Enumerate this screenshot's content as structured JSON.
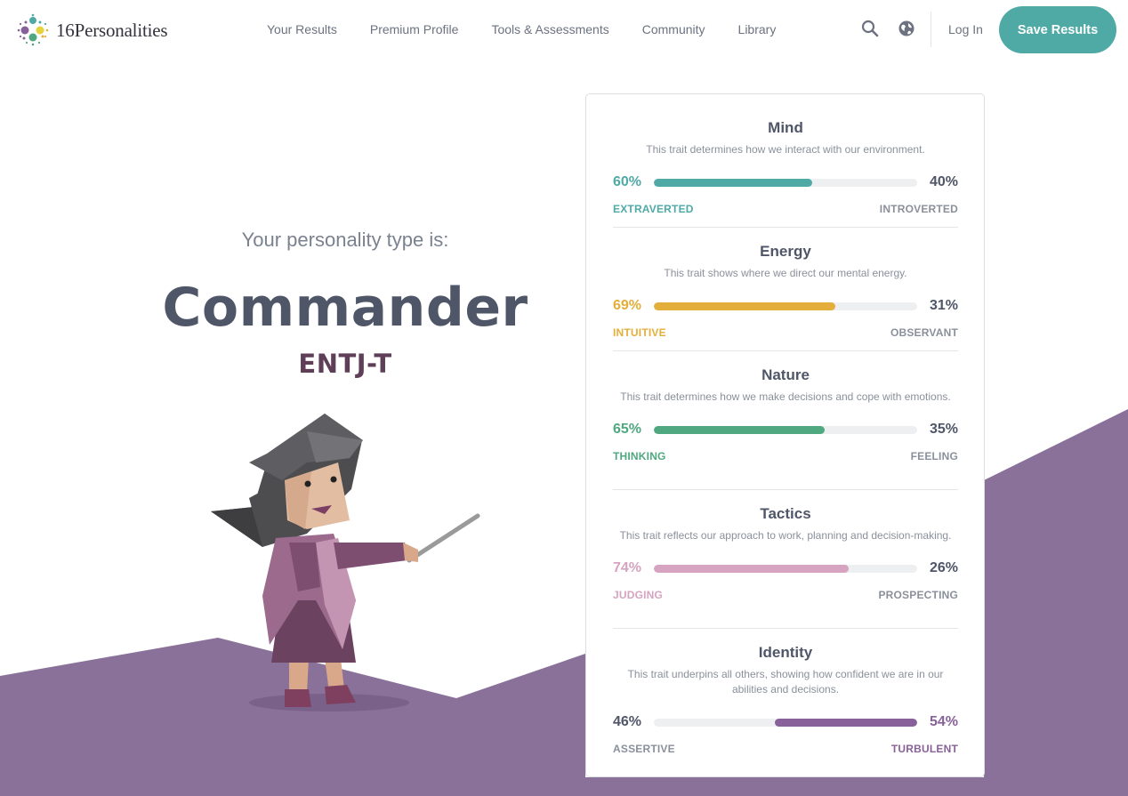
{
  "brand": {
    "name": "16Personalities",
    "colors": {
      "teal": "#4faaa6",
      "purple": "#88619a",
      "bg_purple": "#8a7199"
    }
  },
  "nav": {
    "items": [
      {
        "label": "Your Results"
      },
      {
        "label": "Premium Profile"
      },
      {
        "label": "Tools & Assessments"
      },
      {
        "label": "Community"
      },
      {
        "label": "Library"
      }
    ],
    "search_icon": "search-icon",
    "language_icon": "globe-icon",
    "login_label": "Log In",
    "save_label": "Save Results"
  },
  "intro": {
    "label": "Your personality type is:",
    "type_name": "Commander",
    "type_code": "ENTJ-T"
  },
  "traits": [
    {
      "title": "Mind",
      "description": "This trait determines how we interact with our environment.",
      "left_pct": "60%",
      "right_pct": "40%",
      "left_label": "EXTRAVERTED",
      "right_label": "INTROVERTED",
      "fill_value": 0.6,
      "fill_side": "left",
      "color": "#4faaa6"
    },
    {
      "title": "Energy",
      "description": "This trait shows where we direct our mental energy.",
      "left_pct": "69%",
      "right_pct": "31%",
      "left_label": "INTUITIVE",
      "right_label": "OBSERVANT",
      "fill_value": 0.69,
      "fill_side": "left",
      "color": "#e4ae3a"
    },
    {
      "title": "Nature",
      "description": "This trait determines how we make decisions and cope with emotions.",
      "left_pct": "65%",
      "right_pct": "35%",
      "left_label": "THINKING",
      "right_label": "FEELING",
      "fill_value": 0.65,
      "fill_side": "left",
      "color": "#4fa87f"
    },
    {
      "title": "Tactics",
      "description": "This trait reflects our approach to work, planning and decision-making.",
      "left_pct": "74%",
      "right_pct": "26%",
      "left_label": "JUDGING",
      "right_label": "PROSPECTING",
      "fill_value": 0.74,
      "fill_side": "left",
      "color": "#d6a3c1"
    },
    {
      "title": "Identity",
      "description": "This trait underpins all others, showing how confident we are in our abilities and decisions.",
      "left_pct": "46%",
      "right_pct": "54%",
      "left_label": "ASSERTIVE",
      "right_label": "TURBULENT",
      "fill_value": 0.54,
      "fill_side": "right",
      "color": "#88619a"
    }
  ]
}
